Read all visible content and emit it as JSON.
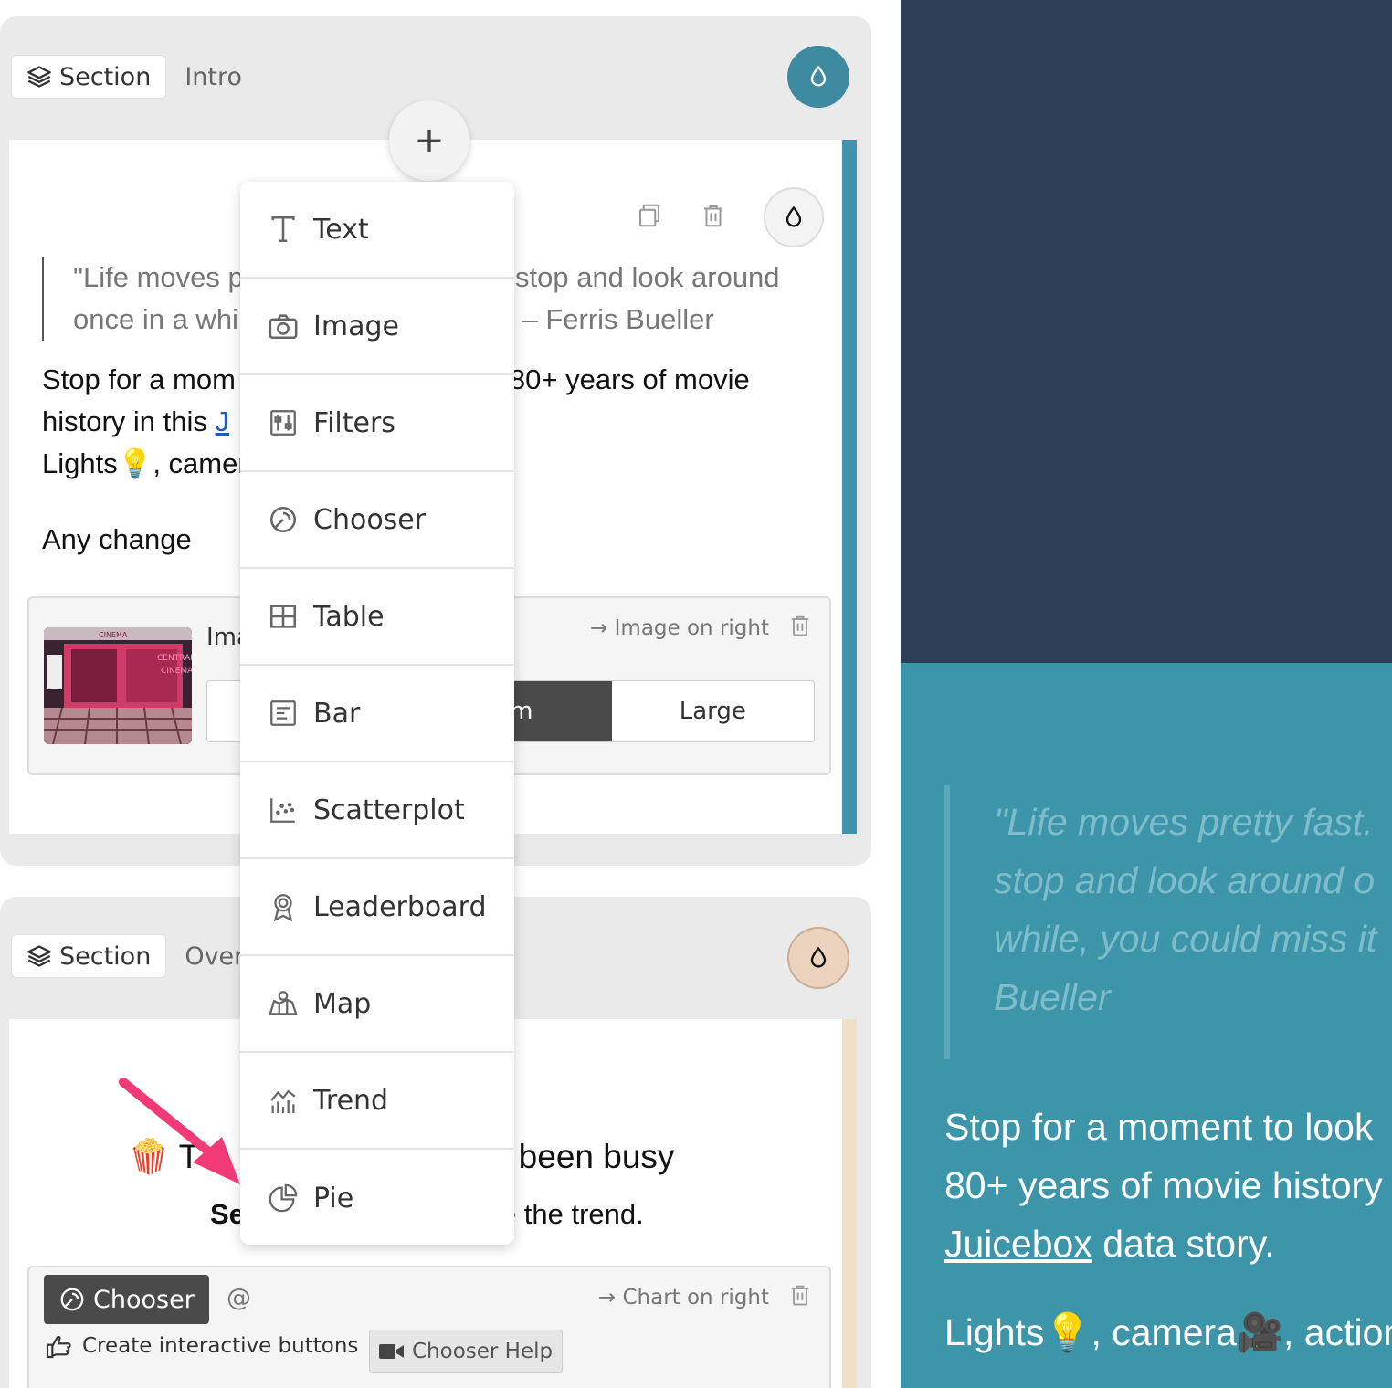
{
  "section1": {
    "tag_label": "Section",
    "name": "Intro",
    "add_symbol": "+",
    "quote_line1": "\"Life moves p",
    "quote_line1_end": "t stop and look around",
    "quote_line2": "once in a whi",
    "quote_line2_end": "' – Ferris Bueller",
    "body_line1": "Stop for a mom",
    "body_line1_end": "80+ years of movie",
    "body_line2": "history in this ",
    "body_link": "J",
    "body_line3": "Lights💡, camer",
    "any_change": "Any change",
    "image_config": {
      "label": "Ima",
      "position": "→ Image on right",
      "sizes": [
        "",
        "ium",
        "Large"
      ],
      "thumb_text": [
        "CINEMA",
        "CENTRAL",
        "CINEMA"
      ]
    }
  },
  "section2": {
    "tag_label": "Section",
    "name": "Over",
    "heading_emoji": "🍿",
    "heading_start": "T",
    "heading_end": "as been busy",
    "sub_bold": "Se",
    "sub_end": "e the trend.",
    "chooser": {
      "pill_label": "Chooser",
      "at": "@",
      "position": "→ Chart on right",
      "create_label": "Create interactive buttons",
      "help_label": "Chooser Help"
    }
  },
  "add_menu": {
    "items": [
      {
        "label": "Text",
        "icon": "text-icon"
      },
      {
        "label": "Image",
        "icon": "camera-icon"
      },
      {
        "label": "Filters",
        "icon": "filters-icon"
      },
      {
        "label": "Chooser",
        "icon": "chooser-icon"
      },
      {
        "label": "Table",
        "icon": "table-icon"
      },
      {
        "label": "Bar",
        "icon": "bar-icon"
      },
      {
        "label": "Scatterplot",
        "icon": "scatterplot-icon"
      },
      {
        "label": "Leaderboard",
        "icon": "leaderboard-icon"
      },
      {
        "label": "Map",
        "icon": "map-icon"
      },
      {
        "label": "Trend",
        "icon": "trend-icon"
      },
      {
        "label": "Pie",
        "icon": "pie-icon"
      }
    ]
  },
  "preview": {
    "quote_lines": [
      "\"Life moves pretty fast.",
      "stop and look around o",
      "while, you could miss it",
      "Bueller"
    ],
    "body_line1": "Stop for a moment to look",
    "body_line2": "80+ years of movie history",
    "body_link": "Juicebox",
    "body_line3_end": " data story.",
    "lights": "Lights💡, camera🎥, action"
  },
  "colors": {
    "accent_teal": "#3e95ab",
    "preview_dark": "#2d3f57",
    "preview_teal": "#3d95aa",
    "section2_accent": "#f1e0c8",
    "annotation_arrow": "#f23a76"
  }
}
